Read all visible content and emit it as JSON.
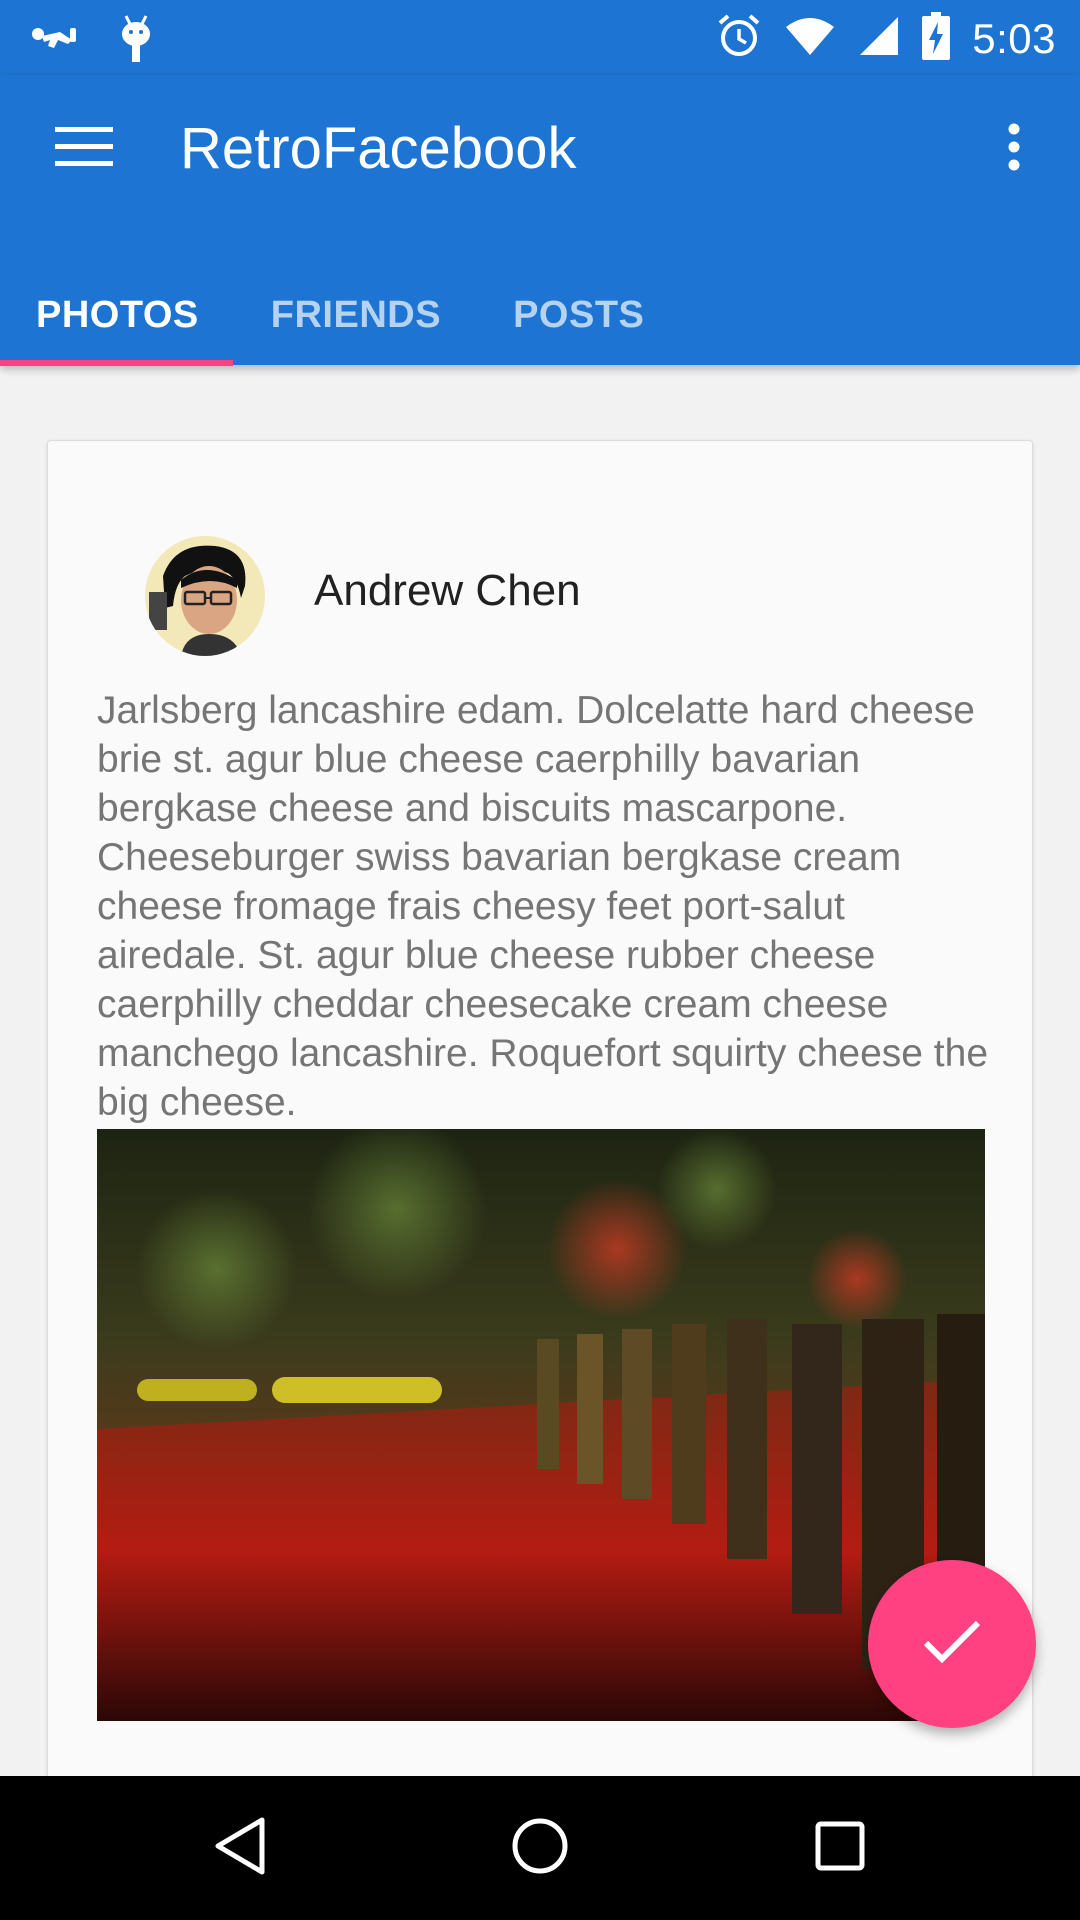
{
  "status_bar": {
    "time": "5:03",
    "left_icons": [
      "baby-crawl-icon",
      "android-debug-icon"
    ],
    "right_icons": [
      "alarm-icon",
      "wifi-icon",
      "signal-icon",
      "battery-charging-icon"
    ]
  },
  "app_bar": {
    "title": "RetroFacebook",
    "menu_icon": "hamburger-menu-icon",
    "overflow_icon": "more-vert-icon",
    "tabs": [
      {
        "label": "PHOTOS",
        "active": true
      },
      {
        "label": "FRIENDS",
        "active": false
      },
      {
        "label": "POSTS",
        "active": false
      }
    ]
  },
  "post": {
    "author": "Andrew Chen",
    "text": "Jarlsberg lancashire edam. Dolcelatte hard cheese brie st. agur blue cheese caerphilly bavarian bergkase cheese and biscuits mascarpone. Cheeseburger swiss bavarian bergkase cream cheese fromage frais cheesy feet port-salut airedale. St. agur blue cheese rubber cheese caerphilly cheddar cheesecake cream cheese manchego lancashire. Roquefort squirty cheese the big cheese."
  },
  "fab": {
    "icon": "check-icon"
  },
  "nav_bar": {
    "icons": [
      "back-icon",
      "home-icon",
      "recents-icon"
    ]
  },
  "colors": {
    "primary": "#1e74d2",
    "accent": "#ff4081",
    "card_background": "#fafafa",
    "body_text": "#757575"
  }
}
